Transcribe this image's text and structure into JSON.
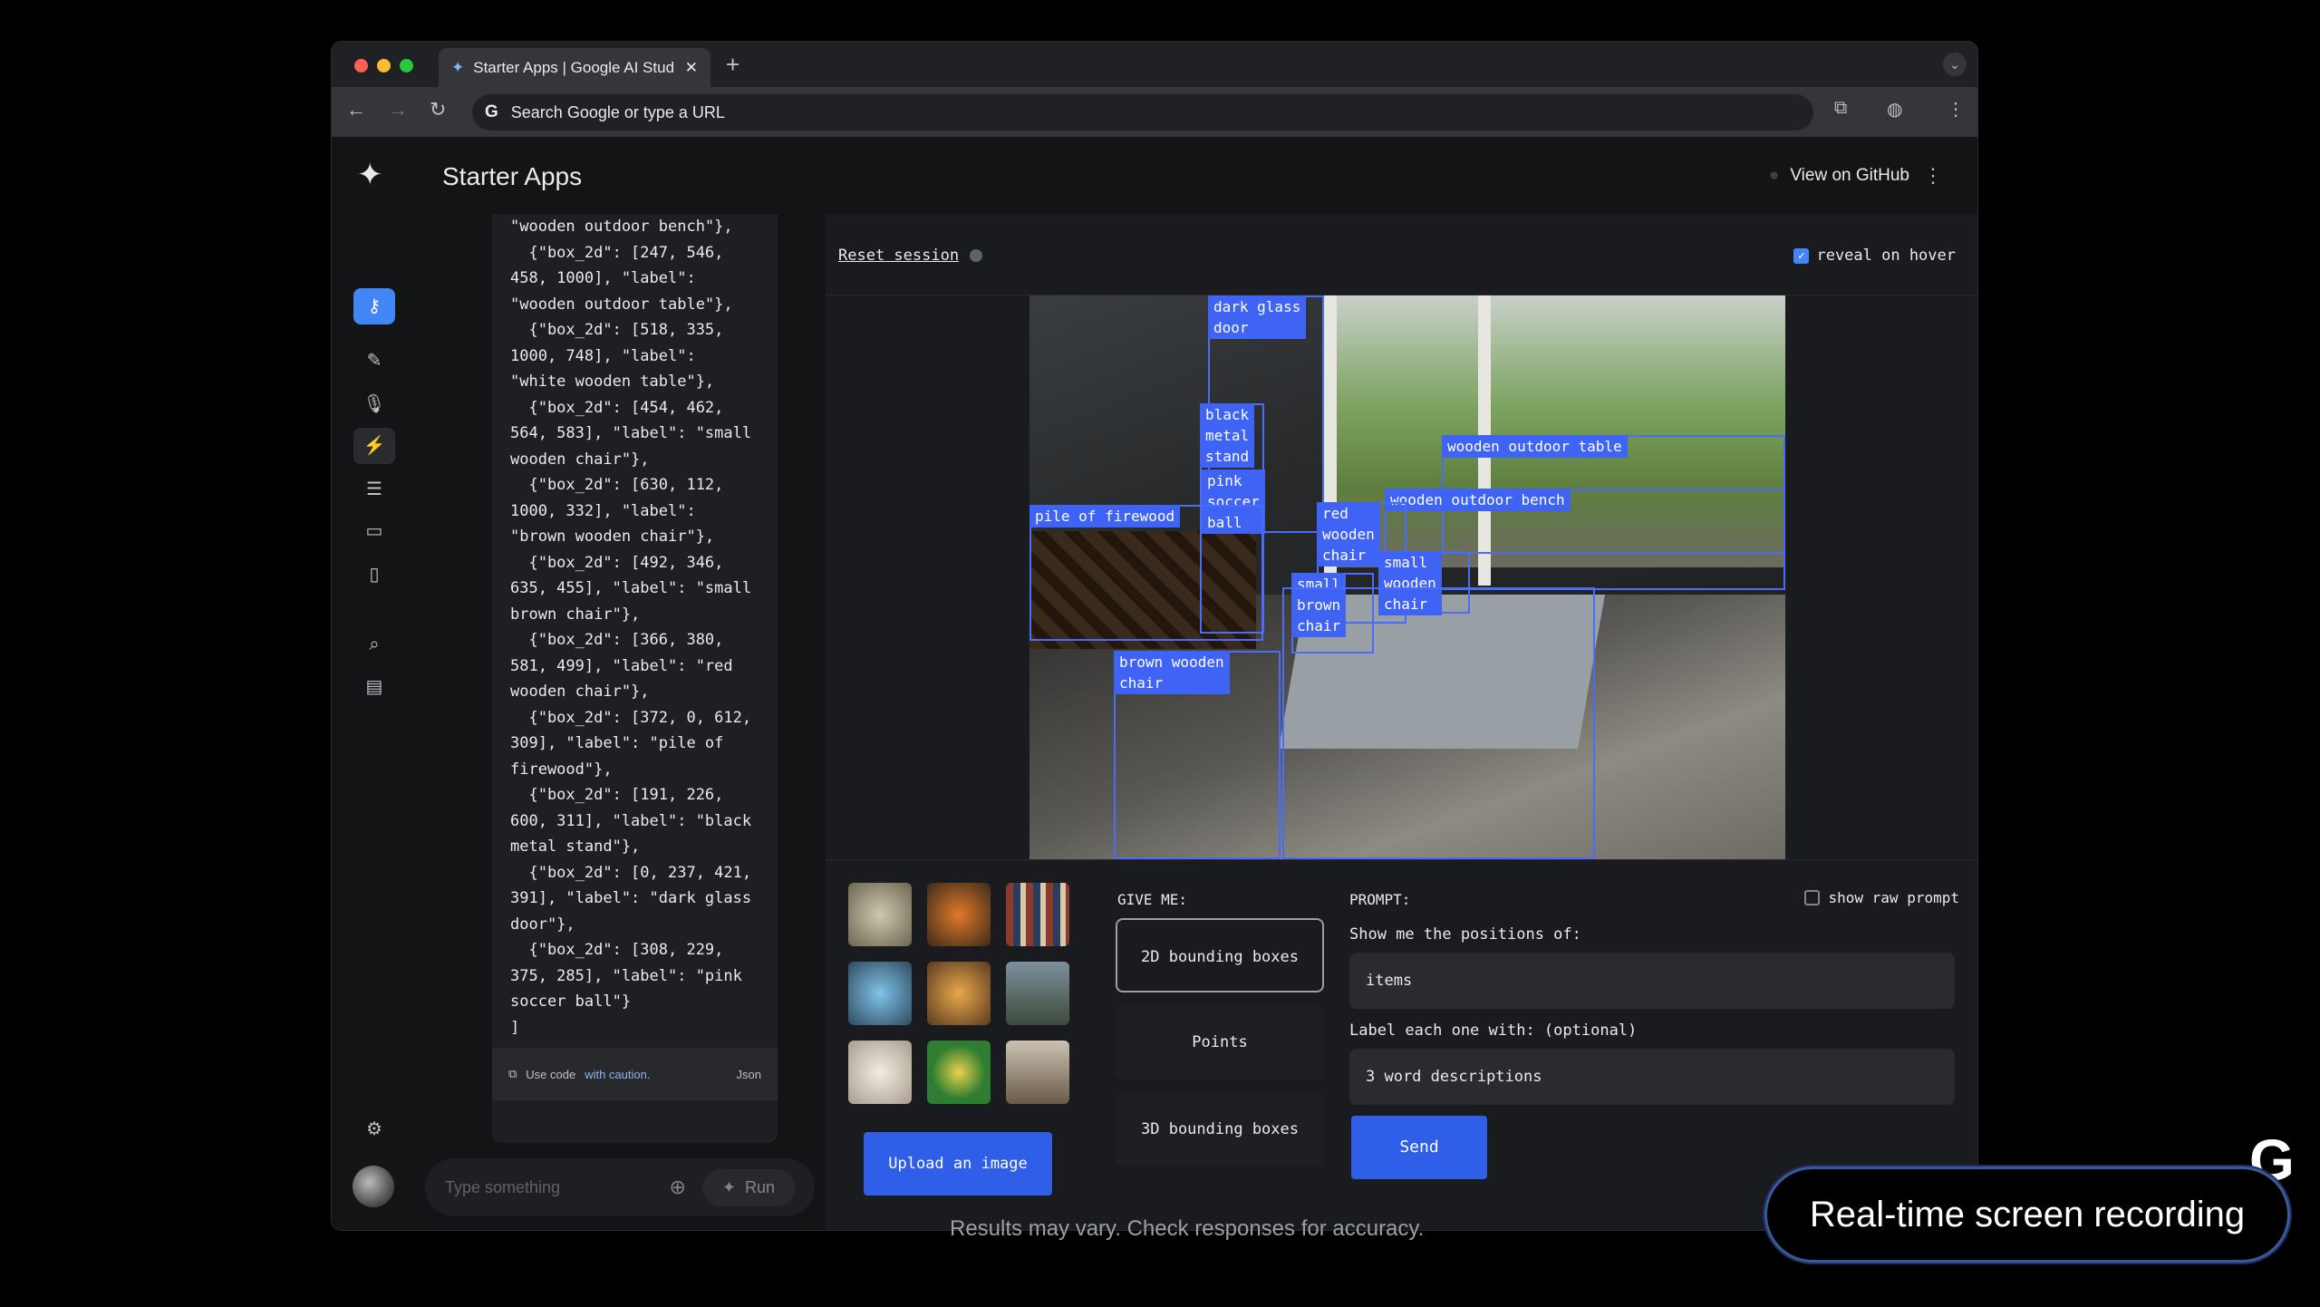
{
  "browser": {
    "tab_title": "Starter Apps | Google AI Stud",
    "omnibox_placeholder": "Search Google or type a URL",
    "omnibox_g": "G"
  },
  "app": {
    "title": "Starter Apps",
    "github_link": "View on GitHub"
  },
  "code": {
    "json_text": "\"wooden outdoor bench\"},\n  {\"box_2d\": [247, 546,\n458, 1000], \"label\":\n\"wooden outdoor table\"},\n  {\"box_2d\": [518, 335,\n1000, 748], \"label\":\n\"white wooden table\"},\n  {\"box_2d\": [454, 462,\n564, 583], \"label\": \"small\nwooden chair\"},\n  {\"box_2d\": [630, 112,\n1000, 332], \"label\":\n\"brown wooden chair\"},\n  {\"box_2d\": [492, 346,\n635, 455], \"label\": \"small\nbrown chair\"},\n  {\"box_2d\": [366, 380,\n581, 499], \"label\": \"red\nwooden chair\"},\n  {\"box_2d\": [372, 0, 612,\n309], \"label\": \"pile of\nfirewood\"},\n  {\"box_2d\": [191, 226,\n600, 311], \"label\": \"black\nmetal stand\"},\n  {\"box_2d\": [0, 237, 421,\n391], \"label\": \"dark glass\ndoor\"},\n  {\"box_2d\": [308, 229,\n375, 285], \"label\": \"pink\nsoccer ball\"}\n]",
    "footer_prefix": "Use code",
    "footer_link": "with caution.",
    "footer_lang": "Json"
  },
  "prompt_bar": {
    "placeholder": "Type something",
    "run_label": "Run"
  },
  "main": {
    "reset_label": "Reset session",
    "reveal_label": "reveal on hover",
    "reveal_checked": true
  },
  "boxes": [
    {
      "label": "dark glass\ndoor"
    },
    {
      "label": "black\nmetal\nstand"
    },
    {
      "label": "pink\nsoccer\nball"
    },
    {
      "label": "wooden outdoor table"
    },
    {
      "label": "wooden outdoor bench"
    },
    {
      "label": "pile of firewood"
    },
    {
      "label": "red\nwooden\nchair"
    },
    {
      "label": "small\nwooden\nchair"
    },
    {
      "label": "small\nbrown\nchair"
    },
    {
      "label": "brown wooden\nchair"
    }
  ],
  "controls": {
    "give_me_label": "GIVE ME:",
    "options": [
      "2D bounding boxes",
      "Points",
      "3D bounding boxes"
    ],
    "selected_option": "2D bounding boxes",
    "prompt_label": "PROMPT:",
    "show_raw_label": "show raw prompt",
    "positions_label": "Show me the positions of:",
    "positions_value": "items",
    "label_with_label": "Label each one with: (optional)",
    "label_with_value": "3 word descriptions",
    "send_label": "Send",
    "upload_label": "Upload an image"
  },
  "overlay": {
    "disclaimer": "Results may vary. Check responses for accuracy.",
    "recording_label": "Real-time screen recording",
    "brand_letter": "G"
  },
  "colors": {
    "accent": "#4285f4",
    "box": "#3f63f5",
    "button": "#2f5ee8"
  }
}
